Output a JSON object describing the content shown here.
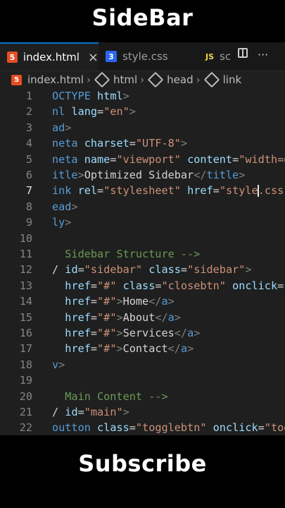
{
  "captions": {
    "top": "SideBar",
    "bottom": "Subscribe"
  },
  "tabs": [
    {
      "label": "index.html",
      "icon": "html5-icon",
      "active": true
    },
    {
      "label": "style.css",
      "icon": "css3-icon"
    },
    {
      "label": "sc",
      "icon": "js-icon",
      "icon_text": "JS"
    }
  ],
  "tab_icons": {
    "html": "5",
    "css": "3",
    "js": "JS",
    "close": "×",
    "more": "···"
  },
  "breadcrumb": [
    "index.html",
    "html",
    "head",
    "link"
  ],
  "colors": {
    "tag": "#569cd6",
    "attribute": "#9cdcfe",
    "string": "#ce9178",
    "comment": "#6a9955",
    "text": "#d4d4d4",
    "accent": "#0078d4"
  },
  "editor": {
    "current_line": 7,
    "lines": [
      {
        "n": "1",
        "segs": [
          [
            "tag",
            "OCTYPE"
          ],
          [
            "plain",
            " "
          ],
          [
            "attr",
            "html"
          ],
          [
            "punct",
            ">"
          ]
        ]
      },
      {
        "n": "2",
        "segs": [
          [
            "tag",
            "nl"
          ],
          [
            "plain",
            " "
          ],
          [
            "attr",
            "lang"
          ],
          [
            "plain",
            "="
          ],
          [
            "str",
            "\"en\""
          ],
          [
            "punct",
            ">"
          ]
        ]
      },
      {
        "n": "3",
        "segs": [
          [
            "tag",
            "ad"
          ],
          [
            "punct",
            ">"
          ]
        ]
      },
      {
        "n": "4",
        "segs": [
          [
            "tag",
            "neta"
          ],
          [
            "plain",
            " "
          ],
          [
            "attr",
            "charset"
          ],
          [
            "plain",
            "="
          ],
          [
            "str",
            "\"UTF-8\""
          ],
          [
            "punct",
            ">"
          ]
        ]
      },
      {
        "n": "5",
        "segs": [
          [
            "tag",
            "neta"
          ],
          [
            "plain",
            " "
          ],
          [
            "attr",
            "name"
          ],
          [
            "plain",
            "="
          ],
          [
            "str",
            "\"viewport\""
          ],
          [
            "plain",
            " "
          ],
          [
            "attr",
            "content"
          ],
          [
            "plain",
            "="
          ],
          [
            "str",
            "\"width=d"
          ]
        ]
      },
      {
        "n": "6",
        "segs": [
          [
            "tag",
            "itle"
          ],
          [
            "punct",
            ">"
          ],
          [
            "plain",
            "Optimized Sidebar"
          ],
          [
            "punct",
            "</"
          ],
          [
            "tag",
            "title"
          ],
          [
            "punct",
            ">"
          ]
        ]
      },
      {
        "n": "7",
        "segs": [
          [
            "tag",
            "ink"
          ],
          [
            "plain",
            " "
          ],
          [
            "attr",
            "rel"
          ],
          [
            "plain",
            "="
          ],
          [
            "str",
            "\"stylesheet\""
          ],
          [
            "plain",
            " "
          ],
          [
            "attr",
            "href"
          ],
          [
            "plain",
            "="
          ],
          [
            "str",
            "\"style"
          ],
          [
            "cursor",
            ""
          ],
          [
            "str",
            ".css"
          ]
        ]
      },
      {
        "n": "8",
        "segs": [
          [
            "tag",
            "ead"
          ],
          [
            "punct",
            ">"
          ]
        ]
      },
      {
        "n": "9",
        "segs": [
          [
            "tag",
            "ly"
          ],
          [
            "punct",
            ">"
          ]
        ]
      },
      {
        "n": "10",
        "segs": []
      },
      {
        "n": "11",
        "segs": [
          [
            "comment",
            "  Sidebar Structure -->"
          ]
        ]
      },
      {
        "n": "12",
        "segs": [
          [
            "plain",
            "/ "
          ],
          [
            "attr",
            "id"
          ],
          [
            "plain",
            "="
          ],
          [
            "str",
            "\"sidebar\""
          ],
          [
            "plain",
            " "
          ],
          [
            "attr",
            "class"
          ],
          [
            "plain",
            "="
          ],
          [
            "str",
            "\"sidebar\""
          ],
          [
            "punct",
            ">"
          ]
        ]
      },
      {
        "n": "13",
        "segs": [
          [
            "plain",
            "  "
          ],
          [
            "attr",
            "href"
          ],
          [
            "plain",
            "="
          ],
          [
            "str",
            "\"#\""
          ],
          [
            "plain",
            " "
          ],
          [
            "attr",
            "class"
          ],
          [
            "plain",
            "="
          ],
          [
            "str",
            "\"closebtn\""
          ],
          [
            "plain",
            " "
          ],
          [
            "attr",
            "onclick"
          ],
          [
            "plain",
            "="
          ],
          [
            "str",
            "\""
          ]
        ]
      },
      {
        "n": "14",
        "segs": [
          [
            "plain",
            "  "
          ],
          [
            "attr",
            "href"
          ],
          [
            "plain",
            "="
          ],
          [
            "str",
            "\"#\""
          ],
          [
            "punct",
            ">"
          ],
          [
            "plain",
            "Home"
          ],
          [
            "punct",
            "</"
          ],
          [
            "tag",
            "a"
          ],
          [
            "punct",
            ">"
          ]
        ]
      },
      {
        "n": "15",
        "segs": [
          [
            "plain",
            "  "
          ],
          [
            "attr",
            "href"
          ],
          [
            "plain",
            "="
          ],
          [
            "str",
            "\"#\""
          ],
          [
            "punct",
            ">"
          ],
          [
            "plain",
            "About"
          ],
          [
            "punct",
            "</"
          ],
          [
            "tag",
            "a"
          ],
          [
            "punct",
            ">"
          ]
        ]
      },
      {
        "n": "16",
        "segs": [
          [
            "plain",
            "  "
          ],
          [
            "attr",
            "href"
          ],
          [
            "plain",
            "="
          ],
          [
            "str",
            "\"#\""
          ],
          [
            "punct",
            ">"
          ],
          [
            "plain",
            "Services"
          ],
          [
            "punct",
            "</"
          ],
          [
            "tag",
            "a"
          ],
          [
            "punct",
            ">"
          ]
        ]
      },
      {
        "n": "17",
        "segs": [
          [
            "plain",
            "  "
          ],
          [
            "attr",
            "href"
          ],
          [
            "plain",
            "="
          ],
          [
            "str",
            "\"#\""
          ],
          [
            "punct",
            ">"
          ],
          [
            "plain",
            "Contact"
          ],
          [
            "punct",
            "</"
          ],
          [
            "tag",
            "a"
          ],
          [
            "punct",
            ">"
          ]
        ]
      },
      {
        "n": "18",
        "segs": [
          [
            "tag",
            "v"
          ],
          [
            "punct",
            ">"
          ]
        ]
      },
      {
        "n": "19",
        "segs": []
      },
      {
        "n": "20",
        "segs": [
          [
            "comment",
            "  Main Content -->"
          ]
        ]
      },
      {
        "n": "21",
        "segs": [
          [
            "plain",
            "/ "
          ],
          [
            "attr",
            "id"
          ],
          [
            "plain",
            "="
          ],
          [
            "str",
            "\"main\""
          ],
          [
            "punct",
            ">"
          ]
        ]
      },
      {
        "n": "22",
        "segs": [
          [
            "tag",
            "outton"
          ],
          [
            "plain",
            " "
          ],
          [
            "attr",
            "class"
          ],
          [
            "plain",
            "="
          ],
          [
            "str",
            "\"togglebtn\""
          ],
          [
            "plain",
            " "
          ],
          [
            "attr",
            "onclick"
          ],
          [
            "plain",
            "="
          ],
          [
            "str",
            "\"tog"
          ]
        ]
      }
    ]
  }
}
